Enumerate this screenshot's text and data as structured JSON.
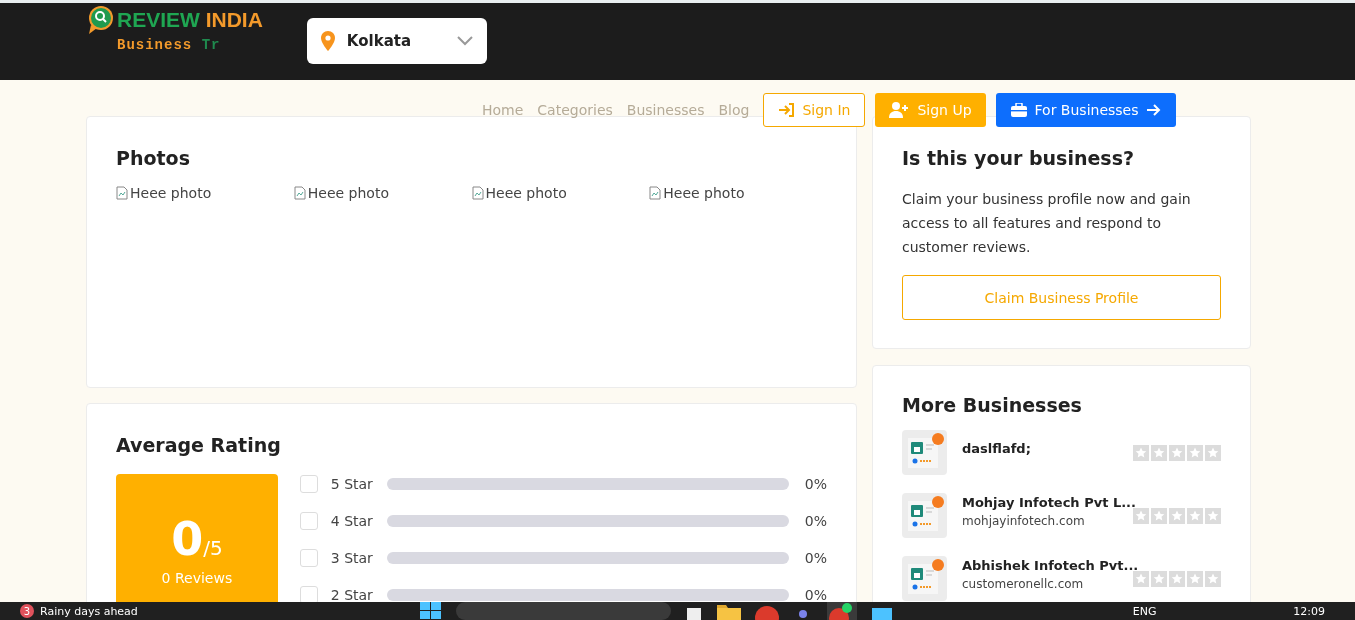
{
  "header": {
    "logo_main": "REVIEW",
    "logo_accent": "INDIA",
    "tagline_main": "Business",
    "tagline_accent": "Tr",
    "location": "Kolkata"
  },
  "nav": {
    "links": [
      "Home",
      "Categories",
      "Businesses",
      "Blog"
    ],
    "sign_in": "Sign In",
    "sign_up": "Sign Up",
    "for_businesses": "For Businesses"
  },
  "photos": {
    "title": "Photos",
    "items": [
      {
        "alt": "Heee photo"
      },
      {
        "alt": "Heee photo"
      },
      {
        "alt": "Heee photo"
      },
      {
        "alt": "Heee photo"
      }
    ]
  },
  "rating": {
    "title": "Average Rating",
    "score": "0",
    "out_of": "/5",
    "reviews": "0 Reviews",
    "rows": [
      {
        "label": "5 Star",
        "checked": false,
        "level": 0,
        "percent": "0%"
      },
      {
        "label": "4 Star",
        "checked": false,
        "level": 0,
        "percent": "0%"
      },
      {
        "label": "3 Star",
        "checked": false,
        "level": 0,
        "percent": "0%"
      },
      {
        "label": "2 Star",
        "checked": false,
        "level": 0,
        "percent": "0%"
      }
    ]
  },
  "claim": {
    "title": "Is this your business?",
    "text": "Claim your business profile now and gain access to all features and respond to customer reviews.",
    "button": "Claim Business Profile"
  },
  "more": {
    "title": "More Businesses",
    "items": [
      {
        "name": "daslflafd;",
        "stars": 0
      },
      {
        "name": "Mohjay Infotech Pvt L...",
        "url": "mohjayinfotech.com",
        "stars": 0
      },
      {
        "name": "Abhishek Infotech Pvt...",
        "url": "customeronellc.com",
        "stars": 0
      }
    ]
  },
  "taskbar": {
    "weather_badge": "3",
    "weather": "Rainy days ahead",
    "language": "ENG",
    "time": "12:09"
  }
}
